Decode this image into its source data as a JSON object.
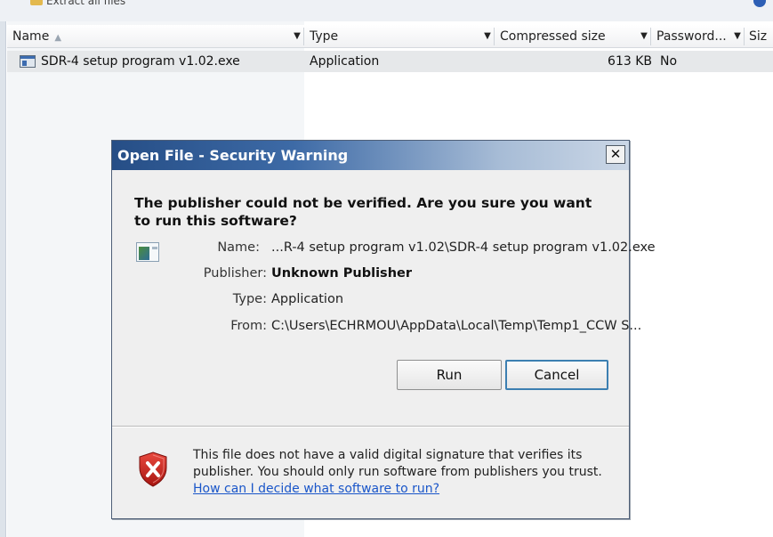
{
  "explorer": {
    "top_partial_text": "Extract all files",
    "columns": [
      {
        "label": "Name"
      },
      {
        "label": "Type"
      },
      {
        "label": "Compressed size"
      },
      {
        "label": "Password..."
      },
      {
        "label": "Siz"
      }
    ],
    "files": [
      {
        "name": "SDR-4 setup program v1.02.exe",
        "type": "Application",
        "compressed_size": "613 KB",
        "password": "No"
      }
    ]
  },
  "dialog": {
    "title": "Open File - Security Warning",
    "close_glyph": "✕",
    "question": "The publisher could not be verified.  Are you sure you want to run this software?",
    "fields": {
      "name_label": "Name:",
      "name_value": "...R-4 setup program v1.02\\SDR-4 setup program v1.02.exe",
      "publisher_label": "Publisher:",
      "publisher_value": "Unknown Publisher",
      "type_label": "Type:",
      "type_value": "Application",
      "from_label": "From:",
      "from_value": "C:\\Users\\ECHRMOU\\AppData\\Local\\Temp\\Temp1_CCW S..."
    },
    "buttons": {
      "run": "Run",
      "cancel": "Cancel"
    },
    "warning": {
      "text": "This file does not have a valid digital signature that verifies its publisher. You should only run software from publishers you trust.",
      "link": "How can I decide what software to run?"
    }
  },
  "colors": {
    "title_gradient_start": "#264e86",
    "title_gradient_end": "#cbd7e6",
    "link": "#1a56c9",
    "shield_red": "#c8221c",
    "default_button_border": "#3c7fb1"
  },
  "icons": [
    "folder-icon",
    "help-icon",
    "sort-ascending-icon",
    "exe-file-icon",
    "application-icon",
    "close-icon",
    "security-shield-icon"
  ]
}
